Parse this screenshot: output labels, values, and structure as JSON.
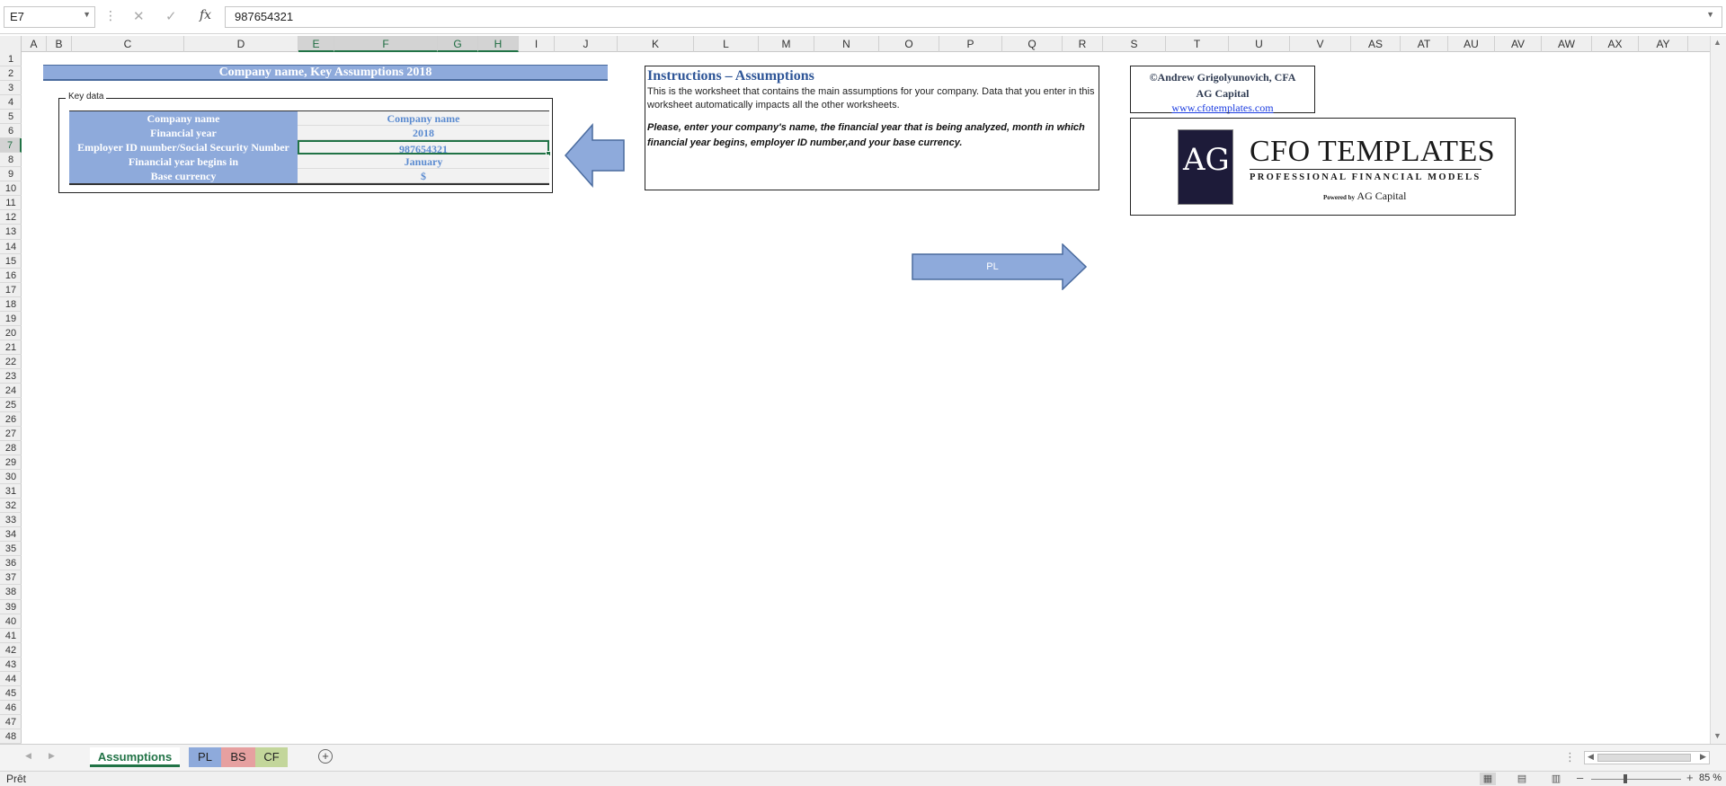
{
  "formula_bar": {
    "name_box": "E7",
    "formula_value": "987654321"
  },
  "columns": [
    "A",
    "B",
    "C",
    "D",
    "E",
    "F",
    "G",
    "H",
    "I",
    "J",
    "K",
    "L",
    "M",
    "N",
    "O",
    "P",
    "Q",
    "R",
    "S",
    "T",
    "U",
    "V",
    "AS",
    "AT",
    "AU",
    "AV",
    "AW",
    "AX",
    "AY"
  ],
  "selected_columns": [
    "E",
    "F",
    "G",
    "H"
  ],
  "rows": [
    "1",
    "2",
    "3",
    "4",
    "5",
    "6",
    "7",
    "8",
    "9",
    "10",
    "11",
    "12",
    "13",
    "14",
    "15",
    "16",
    "17",
    "18",
    "19",
    "20",
    "21",
    "22",
    "23",
    "24",
    "25",
    "26",
    "27",
    "28",
    "29",
    "30",
    "31",
    "32",
    "33",
    "34",
    "35",
    "36",
    "37",
    "38",
    "39",
    "40",
    "41",
    "42",
    "43",
    "44",
    "45",
    "46",
    "47",
    "48"
  ],
  "selected_row": "7",
  "sheet": {
    "title": "Company name, Key Assumptions 2018",
    "key_data": {
      "legend": "Key data",
      "rows": [
        {
          "label": "Company name",
          "value": "Company name"
        },
        {
          "label": "Financial year",
          "value": "2018"
        },
        {
          "label": "Employer ID number/Social Security Number",
          "value": "987654321"
        },
        {
          "label": "Financial year begins in",
          "value": "January"
        },
        {
          "label": "Base currency",
          "value": "$"
        }
      ]
    },
    "instructions": {
      "title": "Instructions – Assumptions",
      "body": "This is the worksheet that contains the main assumptions for your company. Data that you enter in this worksheet automatically impacts all the other worksheets.",
      "note": "Please, enter your company's name, the financial year that is being analyzed, month in which financial year begins, employer ID number,and your base currency."
    },
    "credits": {
      "author": "©Andrew Grigolyunovich, CFA",
      "company": "AG Capital",
      "link": "www.cfotemplates.com"
    },
    "logo": {
      "mark": "AG",
      "title": "CFO TEMPLATES",
      "subtitle": "PROFESSIONAL FINANCIAL MODELS",
      "powered_prefix": "Powered by",
      "powered_name": "AG Capital"
    },
    "nav_arrow_label": "PL"
  },
  "tabs": {
    "active": "Assumptions",
    "items": [
      {
        "label": "Assumptions",
        "color": "#ffffff"
      },
      {
        "label": "PL",
        "color": "#8eaadb"
      },
      {
        "label": "BS",
        "color": "#e6a0a0"
      },
      {
        "label": "CF",
        "color": "#c3d69b"
      }
    ]
  },
  "status": {
    "text": "Prêt",
    "zoom": "85 %"
  },
  "colors": {
    "accent": "#217346",
    "header_band": "#8eaadb",
    "value_text": "#5b8bd0",
    "title_text": "#2e5597"
  }
}
